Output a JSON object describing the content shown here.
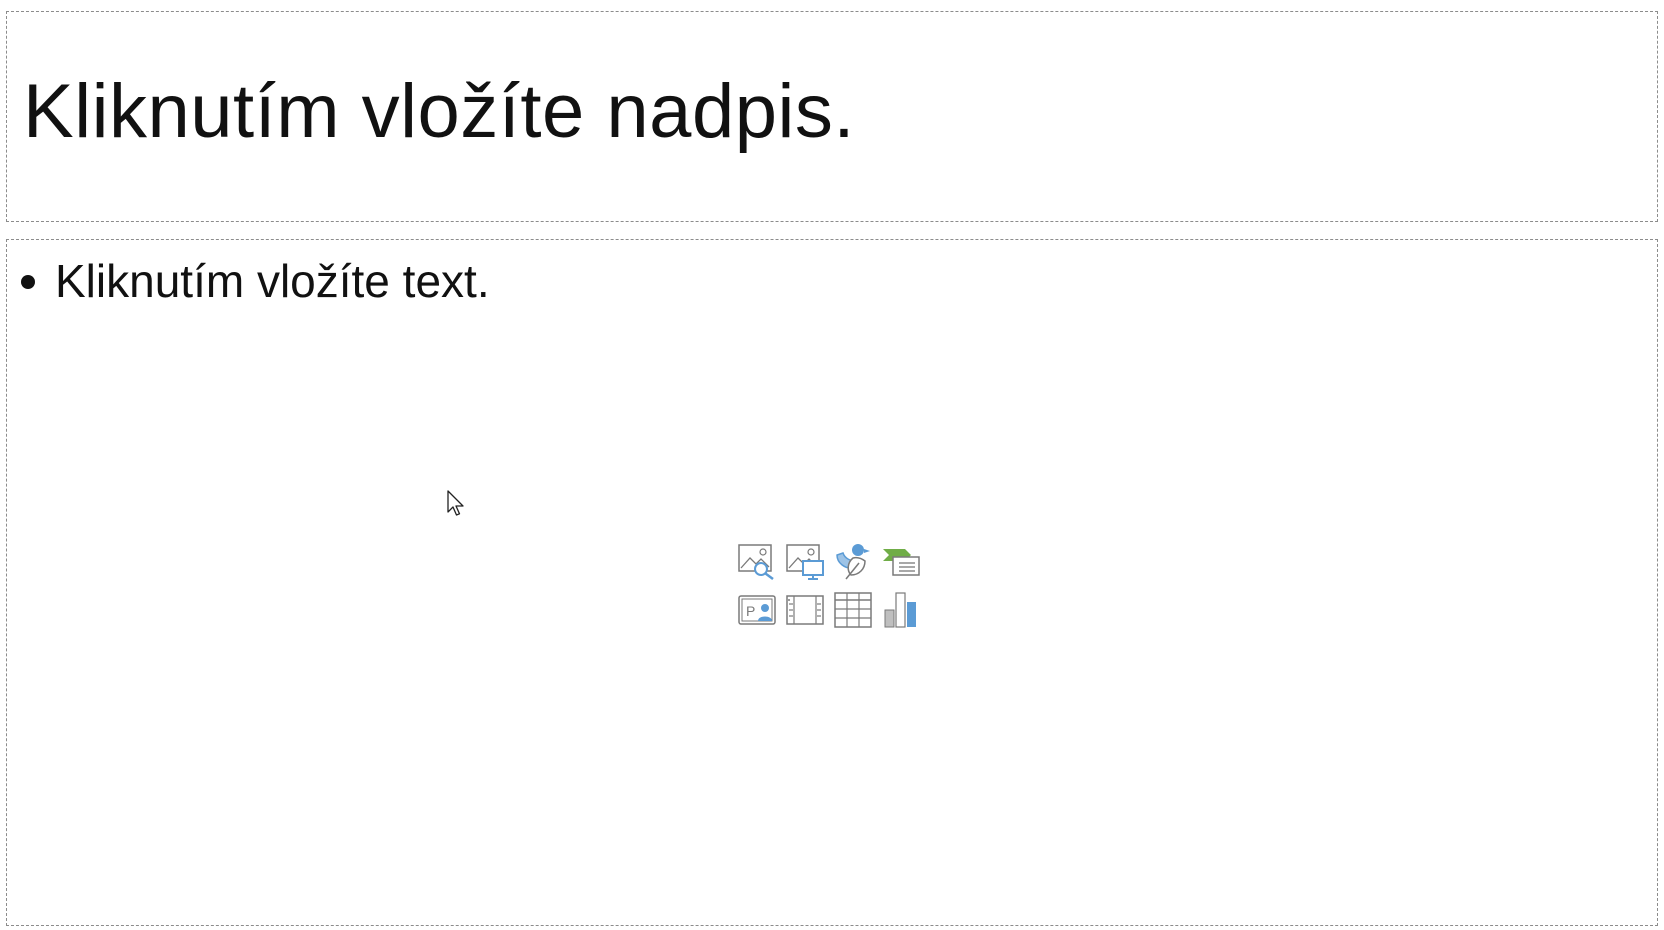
{
  "slide": {
    "title_placeholder": "Kliknutím vložíte nadpis.",
    "content_placeholder": "Kliknutím vložíte text."
  },
  "insert_icons": [
    {
      "name": "stock-images-icon"
    },
    {
      "name": "online-pictures-icon"
    },
    {
      "name": "icons-icon"
    },
    {
      "name": "smartart-icon"
    },
    {
      "name": "cameo-icon"
    },
    {
      "name": "video-icon"
    },
    {
      "name": "table-icon"
    },
    {
      "name": "chart-icon"
    }
  ],
  "colors": {
    "icon_gray": "#7a7a7a",
    "icon_blue": "#5b9bd5",
    "icon_light_blue": "#9dc3e6",
    "icon_green": "#70ad47",
    "border_dashed": "#8c8c8c",
    "text": "#111111"
  }
}
